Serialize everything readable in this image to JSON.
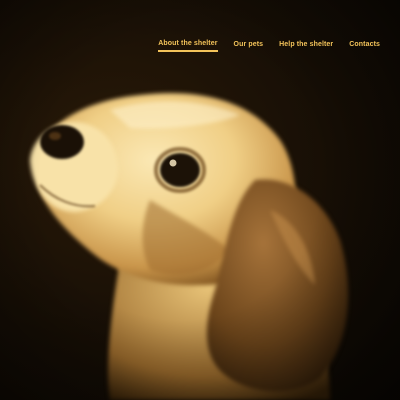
{
  "nav": {
    "items": [
      {
        "label": "About the shelter",
        "active": true
      },
      {
        "label": "Our pets",
        "active": false
      },
      {
        "label": "Help the shelter",
        "active": false
      },
      {
        "label": "Contacts",
        "active": false
      }
    ]
  },
  "hero": {
    "image": "beagle-puppy-photo"
  },
  "colors": {
    "accent": "#f3c35a",
    "background": "#110b04",
    "fur_light": "#f6dd9f",
    "fur_shadow": "#8a5b22",
    "ear": "#6b441a"
  }
}
